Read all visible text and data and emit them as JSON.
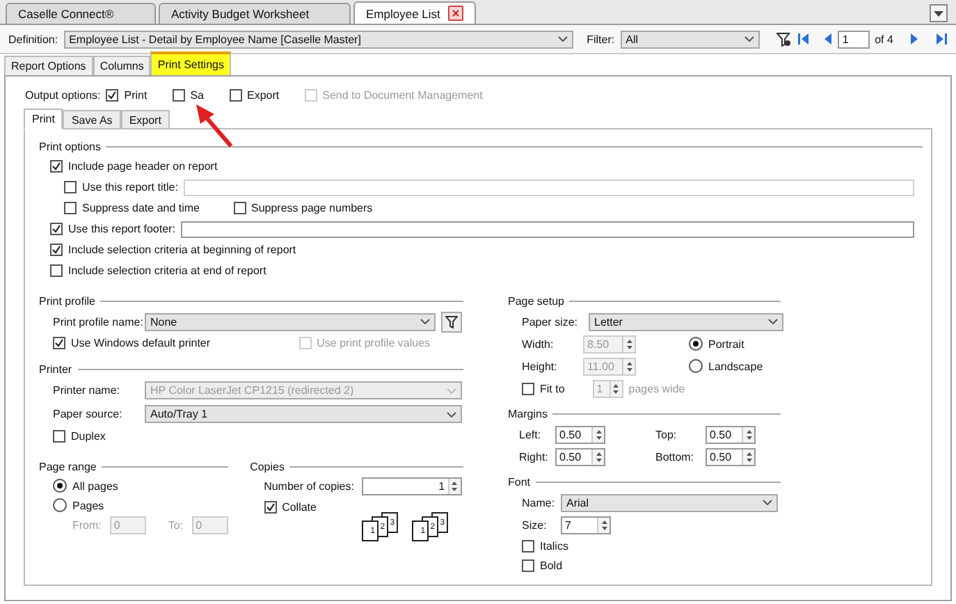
{
  "doc_tabs": [
    {
      "label": "Caselle Connect®",
      "selected": false,
      "closable": false
    },
    {
      "label": "Activity Budget Worksheet",
      "selected": false,
      "closable": false
    },
    {
      "label": "Employee List",
      "selected": true,
      "closable": true
    }
  ],
  "toolbar": {
    "definition_label": "Definition:",
    "definition_value": "Employee List - Detail by Employee Name [Caselle Master]",
    "filter_label": "Filter:",
    "filter_value": "All",
    "page": "1",
    "page_count": "of 4"
  },
  "section_tabs": [
    {
      "label": "Report Options",
      "selected": false,
      "highlighted": false
    },
    {
      "label": "Columns",
      "selected": false,
      "highlighted": false
    },
    {
      "label": "Print Settings",
      "selected": true,
      "highlighted": true
    }
  ],
  "output_options": {
    "label": "Output options:",
    "items": [
      {
        "label": "Print",
        "checked": true
      },
      {
        "label": "Sa",
        "checked": false
      },
      {
        "label": "Export",
        "checked": false
      },
      {
        "label": "Send to Document Management",
        "checked": false,
        "disabled": true
      }
    ]
  },
  "inner_tabs": [
    {
      "label": "Print",
      "selected": true
    },
    {
      "label": "Save As",
      "selected": false
    },
    {
      "label": "Export",
      "selected": false
    }
  ],
  "print_options": {
    "title": "Print options",
    "rows": [
      {
        "kind": "check",
        "label": "Include page header on report",
        "checked": true,
        "children": [
          {
            "kind": "check-field",
            "label": "Use this report title:",
            "checked": false
          },
          {
            "kind": "check-pair",
            "items": [
              {
                "label": "Suppress date and time",
                "checked": false
              },
              {
                "label": "Suppress page numbers",
                "checked": false
              }
            ]
          }
        ]
      },
      {
        "kind": "check-field",
        "label": "Use this report footer:",
        "checked": true
      },
      {
        "kind": "check",
        "label": "Include selection criteria at beginning of report",
        "checked": true
      },
      {
        "kind": "check",
        "label": "Include selection criteria at end of report",
        "checked": false
      }
    ]
  },
  "print_profile": {
    "title": "Print profile",
    "name_label": "Print profile name:",
    "name_value": "None",
    "use_default": {
      "label": "Use Windows default printer",
      "checked": true
    },
    "use_profile": {
      "label": "Use print profile values",
      "checked": false,
      "disabled": true
    }
  },
  "printer": {
    "title": "Printer",
    "name_label": "Printer name:",
    "name_value": "HP Color LaserJet CP1215 (redirected 2)",
    "name_disabled": true,
    "source_label": "Paper source:",
    "source_value": "Auto/Tray 1",
    "duplex": {
      "label": "Duplex",
      "checked": false
    }
  },
  "page_range": {
    "title": "Page range",
    "options": [
      {
        "label": "All pages",
        "selected": true
      },
      {
        "label": "Pages",
        "selected": false
      }
    ],
    "from_label": "From:",
    "from_value": "0",
    "to_label": "To:",
    "to_value": "0"
  },
  "copies": {
    "title": "Copies",
    "number_label": "Number of copies:",
    "number_value": "1",
    "collate": {
      "label": "Collate",
      "checked": true
    },
    "collate_stacks": [
      [
        "1",
        "2",
        "3"
      ],
      [
        "1",
        "2",
        "3"
      ]
    ]
  },
  "page_setup": {
    "title": "Page setup",
    "size_label": "Paper size:",
    "size_value": "Letter",
    "width_label": "Width:",
    "width_value": "8.50",
    "height_label": "Height:",
    "height_value": "11.00",
    "orientation": [
      {
        "label": "Portrait",
        "selected": true
      },
      {
        "label": "Landscape",
        "selected": false
      }
    ],
    "fit": {
      "label": "Fit to",
      "checked": false,
      "value": "1",
      "suffix": "pages wide"
    }
  },
  "margins": {
    "title": "Margins",
    "items": [
      {
        "label": "Left:",
        "value": "0.50"
      },
      {
        "label": "Top:",
        "value": "0.50"
      },
      {
        "label": "Right:",
        "value": "0.50"
      },
      {
        "label": "Bottom:",
        "value": "0.50"
      }
    ]
  },
  "font": {
    "title": "Font",
    "name_label": "Name:",
    "name_value": "Arial",
    "size_label": "Size:",
    "size_value": "7",
    "italics": {
      "label": "Italics",
      "checked": false
    },
    "bold": {
      "label": "Bold",
      "checked": false
    }
  }
}
